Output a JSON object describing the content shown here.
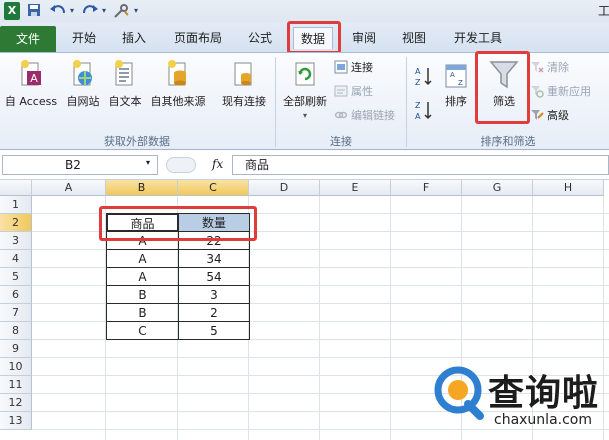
{
  "qat": {
    "app_icon": "X",
    "save_icon": "save-icon",
    "undo_icon": "undo-icon",
    "redo_icon": "redo-icon",
    "title_partial": "工"
  },
  "tabs": {
    "file": "文件",
    "home": "开始",
    "insert": "插入",
    "page_layout": "页面布局",
    "formulas": "公式",
    "data": "数据",
    "review": "审阅",
    "view": "视图",
    "developer": "开发工具"
  },
  "ribbon": {
    "external": {
      "access": "自 Access",
      "web": "自网站",
      "text": "自文本",
      "other": "自其他来源",
      "existing": "现有连接",
      "group_label": "获取外部数据"
    },
    "connections": {
      "refresh_all": "全部刷新",
      "connections": "连接",
      "properties": "属性",
      "edit_links": "编辑链接",
      "group_label": "连接"
    },
    "sort_filter": {
      "sort_az": "A→Z",
      "sort_za": "Z→A",
      "sort": "排序",
      "filter": "筛选",
      "clear": "清除",
      "reapply": "重新应用",
      "advanced": "高级",
      "group_label": "排序和筛选"
    }
  },
  "formula_bar": {
    "name_box": "B2",
    "fx": "fx",
    "content": "商品"
  },
  "grid": {
    "columns": [
      "A",
      "B",
      "C",
      "D",
      "E",
      "F",
      "G",
      "H"
    ],
    "rows": [
      "1",
      "2",
      "3",
      "4",
      "5",
      "6",
      "7",
      "8",
      "9",
      "10",
      "11",
      "12",
      "13"
    ],
    "table": {
      "headers": [
        "商品",
        "数量"
      ],
      "rows": [
        [
          "A",
          "22"
        ],
        [
          "A",
          "34"
        ],
        [
          "A",
          "54"
        ],
        [
          "B",
          "3"
        ],
        [
          "B",
          "2"
        ],
        [
          "C",
          "5"
        ]
      ]
    }
  },
  "watermark": {
    "text": "查询啦",
    "url": "chaxunla.com"
  },
  "colors": {
    "file_tab": "#2e7a34",
    "highlight": "#e03c3c",
    "selected_header": "#f1c85b"
  }
}
